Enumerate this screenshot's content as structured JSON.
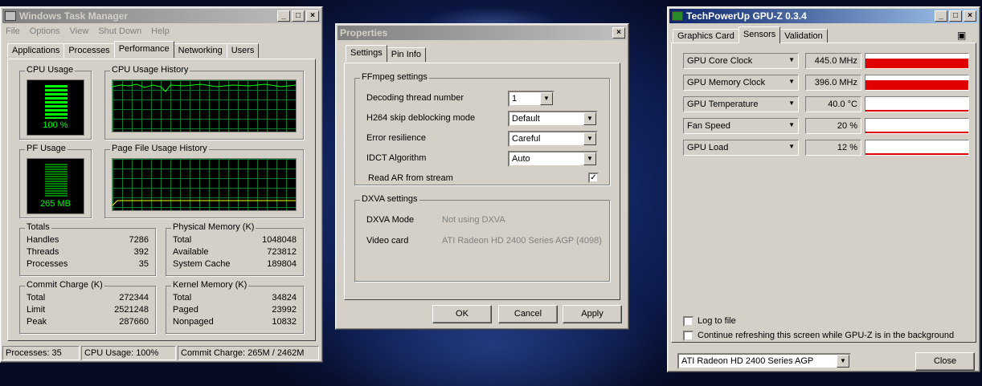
{
  "taskmgr": {
    "title": "Windows Task Manager",
    "menu": [
      "File",
      "Options",
      "View",
      "Shut Down",
      "Help"
    ],
    "tabs": [
      "Applications",
      "Processes",
      "Performance",
      "Networking",
      "Users"
    ],
    "cpu_usage_label": "CPU Usage",
    "cpu_usage_value": "100 %",
    "cpu_history_label": "CPU Usage History",
    "pf_usage_label": "PF Usage",
    "pf_usage_value": "265 MB",
    "pf_history_label": "Page File Usage History",
    "totals": {
      "label": "Totals",
      "rows": [
        [
          "Handles",
          "7286"
        ],
        [
          "Threads",
          "392"
        ],
        [
          "Processes",
          "35"
        ]
      ]
    },
    "physical": {
      "label": "Physical Memory (K)",
      "rows": [
        [
          "Total",
          "1048048"
        ],
        [
          "Available",
          "723812"
        ],
        [
          "System Cache",
          "189804"
        ]
      ]
    },
    "commit": {
      "label": "Commit Charge (K)",
      "rows": [
        [
          "Total",
          "272344"
        ],
        [
          "Limit",
          "2521248"
        ],
        [
          "Peak",
          "287660"
        ]
      ]
    },
    "kernel": {
      "label": "Kernel Memory (K)",
      "rows": [
        [
          "Total",
          "34824"
        ],
        [
          "Paged",
          "23992"
        ],
        [
          "Nonpaged",
          "10832"
        ]
      ]
    },
    "status": {
      "processes": "Processes: 35",
      "cpu": "CPU Usage: 100%",
      "commit": "Commit Charge: 265M / 2462M"
    }
  },
  "props": {
    "title": "Properties",
    "tabs": [
      "Settings",
      "Pin Info"
    ],
    "ffmpeg_label": "FFmpeg settings",
    "decoding_label": "Decoding thread number",
    "decoding_value": "1",
    "h264_label": "H264 skip deblocking mode",
    "h264_value": "Default",
    "error_label": "Error resilience",
    "error_value": "Careful",
    "idct_label": "IDCT Algorithm",
    "idct_value": "Auto",
    "readar_label": "Read AR from stream",
    "readar_checked": true,
    "dxva_label": "DXVA settings",
    "dxva_mode_label": "DXVA Mode",
    "dxva_mode_value": "Not using DXVA",
    "videocard_label": "Video card",
    "videocard_value": "ATI Radeon HD 2400 Series AGP (4098)",
    "ok": "OK",
    "cancel": "Cancel",
    "apply": "Apply"
  },
  "gpuz": {
    "title": "TechPowerUp GPU-Z 0.3.4",
    "tabs": [
      "Graphics Card",
      "Sensors",
      "Validation"
    ],
    "sensors": [
      {
        "name": "GPU Core Clock",
        "value": "445.0 MHz",
        "level": 1.0
      },
      {
        "name": "GPU Memory Clock",
        "value": "396.0 MHz",
        "level": 1.0
      },
      {
        "name": "GPU Temperature",
        "value": "40.0 °C",
        "level": 0.15
      },
      {
        "name": "Fan Speed",
        "value": "20 %",
        "level": 0.2
      },
      {
        "name": "GPU Load",
        "value": "12 %",
        "level": 0.12
      }
    ],
    "log_label": "Log to file",
    "continue_label": "Continue refreshing this screen while GPU-Z is in the background",
    "card_select": "ATI Radeon HD 2400 Series AGP",
    "close": "Close",
    "bar_color": "#e00000"
  }
}
